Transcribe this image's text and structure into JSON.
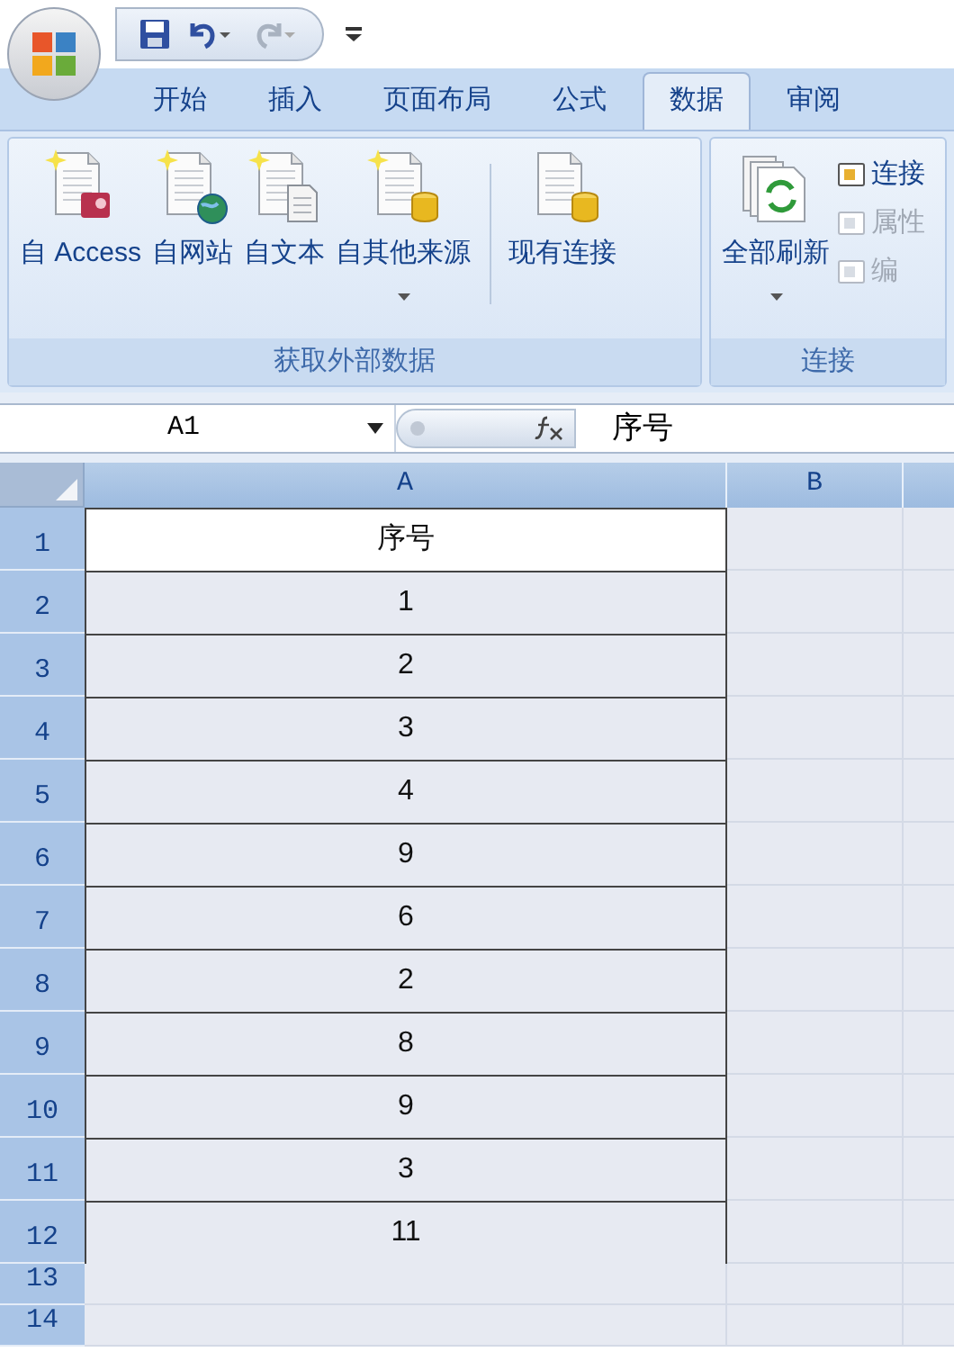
{
  "quick_access": {
    "items": [
      {
        "kind": "save",
        "disabled": false
      },
      {
        "kind": "undo",
        "disabled": false
      },
      {
        "kind": "redo",
        "disabled": true
      }
    ]
  },
  "tabs": [
    {
      "label": "开始",
      "selected": false
    },
    {
      "label": "插入",
      "selected": false
    },
    {
      "label": "页面布局",
      "selected": false
    },
    {
      "label": "公式",
      "selected": false
    },
    {
      "label": "数据",
      "selected": true
    },
    {
      "label": "审阅",
      "selected": false
    }
  ],
  "ribbon": {
    "groups": [
      {
        "title": "获取外部数据",
        "buttons": [
          {
            "label": "自 Access",
            "kind": "access",
            "dropdown": false
          },
          {
            "label": "自网站",
            "kind": "web",
            "dropdown": false
          },
          {
            "label": "自文本",
            "kind": "text",
            "dropdown": false
          },
          {
            "label": "自其他来源",
            "kind": "other",
            "dropdown": true
          },
          {
            "label": "现有连接",
            "kind": "existing",
            "dropdown": false
          }
        ]
      },
      {
        "title": "连接",
        "buttons": [
          {
            "label": "全部刷新",
            "kind": "refresh",
            "dropdown": true
          }
        ],
        "small_buttons": [
          {
            "label": "连接",
            "disabled": false
          },
          {
            "label": "属性",
            "disabled": true
          },
          {
            "label": "编",
            "disabled": true
          }
        ]
      }
    ]
  },
  "formula_bar": {
    "name_box": "A1",
    "formula": "序号"
  },
  "columns": [
    "A",
    "B"
  ],
  "rows": [
    {
      "number": "1",
      "a": "序号",
      "active": true
    },
    {
      "number": "2",
      "a": "1",
      "active": false
    },
    {
      "number": "3",
      "a": "2",
      "active": false
    },
    {
      "number": "4",
      "a": "3",
      "active": false
    },
    {
      "number": "5",
      "a": "4",
      "active": false
    },
    {
      "number": "6",
      "a": "9",
      "active": false
    },
    {
      "number": "7",
      "a": "6",
      "active": false
    },
    {
      "number": "8",
      "a": "2",
      "active": false
    },
    {
      "number": "9",
      "a": "8",
      "active": false
    },
    {
      "number": "10",
      "a": "9",
      "active": false
    },
    {
      "number": "11",
      "a": "3",
      "active": false
    },
    {
      "number": "12",
      "a": "11",
      "active": false
    },
    {
      "number": "13",
      "active": false
    },
    {
      "number": "14",
      "active": false
    }
  ]
}
